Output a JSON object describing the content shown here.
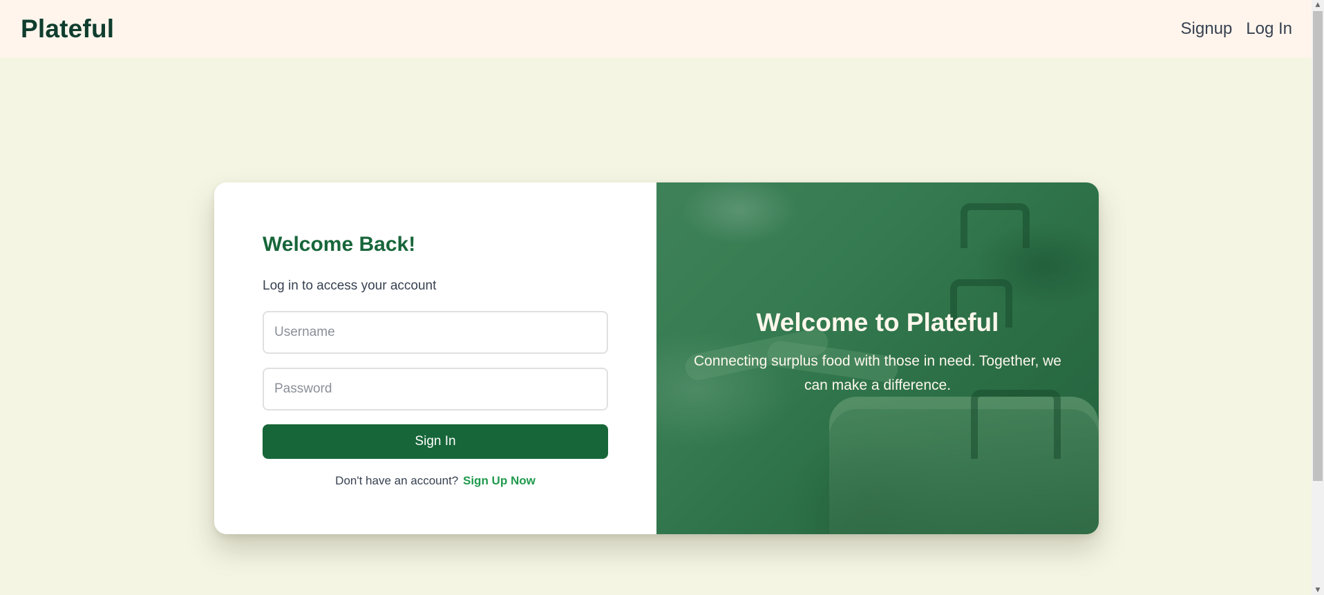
{
  "navbar": {
    "brand": "Plateful",
    "links": [
      {
        "label": "Signup"
      },
      {
        "label": "Log In"
      }
    ]
  },
  "login": {
    "title": "Welcome Back!",
    "subtitle": "Log in to access your account",
    "username_placeholder": "Username",
    "password_placeholder": "Password",
    "submit_label": "Sign In",
    "signup_prompt": "Don't have an account?",
    "signup_link": "Sign Up Now"
  },
  "hero": {
    "title": "Welcome to Plateful",
    "subtitle": "Connecting surplus food with those in need. Together, we can make a difference."
  },
  "colors": {
    "brand_green": "#176639",
    "link_green": "#1f9a4d",
    "page_background": "#f5f5e4",
    "navbar_background": "#fff5ec",
    "brand_text": "#0f3d2e"
  },
  "icons": {
    "scroll_up": "scroll-up-arrow-icon",
    "scroll_down": "scroll-down-arrow-icon"
  }
}
